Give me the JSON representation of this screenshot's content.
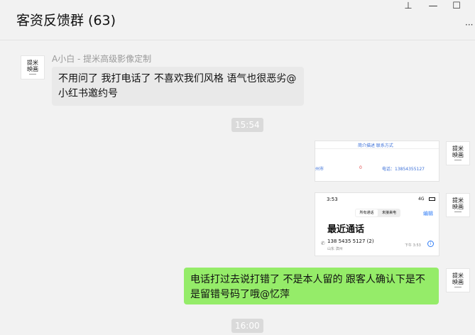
{
  "window": {
    "title": "客资反馈群 (63)",
    "pin_glyph": "⊥",
    "min_glyph": "—",
    "max_glyph": "☐",
    "more_glyph": "···"
  },
  "avatar": {
    "line1": "提米",
    "line2": "映画"
  },
  "messages": {
    "sender": "A小白 - 提米高级影像定制",
    "msg1": "不用问了 我打电话了 不喜欢我们风格 语气也很恶劣@小红书邀约号",
    "time1": "15:54",
    "msg2": "电话打过去说打错了 不是本人留的   跟客人确认下是不是留错号码了哦@忆萍",
    "time2": "16:00"
  },
  "image1": {
    "header": "简介描述   联系方式",
    "col1": "州市",
    "col2": "0",
    "col3": "电话：13854355127"
  },
  "image2": {
    "status_time": "3:53",
    "status_right": "4G",
    "tab_all": "所有通话",
    "tab_missed": "未接来电",
    "edit": "编辑",
    "heading": "最近通话",
    "number": "138 5435 5127 (2)",
    "location": "山东 滨州",
    "call_time": "下午 3:53"
  }
}
